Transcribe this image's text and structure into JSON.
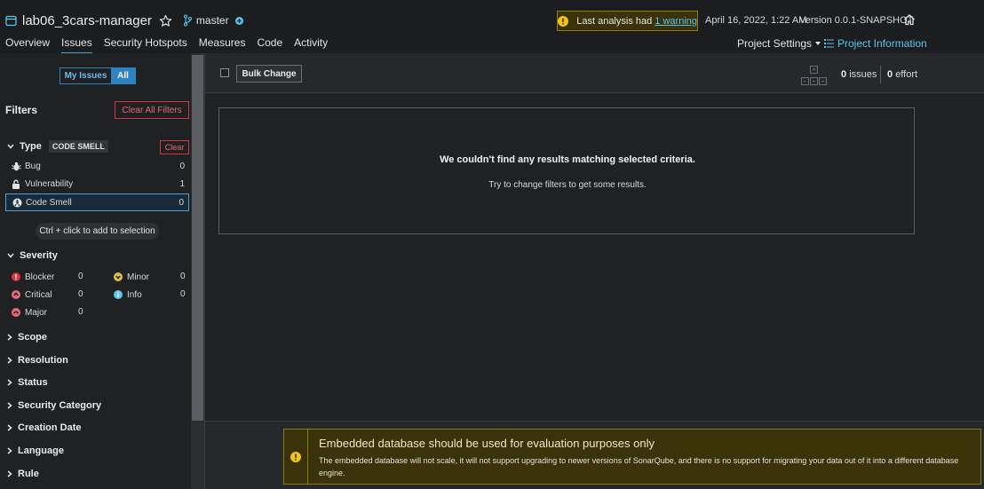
{
  "header": {
    "project_name": "lab06_3cars-manager",
    "branch": "master",
    "warning_prefix": "Last analysis had",
    "warning_link": "1 warning",
    "analysis_date": "April 16, 2022, 1:22 AM",
    "version": "Version 0.0.1-SNAPSHOT",
    "project_settings": "Project Settings",
    "project_information": "Project Information"
  },
  "nav": {
    "overview": "Overview",
    "issues": "Issues",
    "security_hotspots": "Security Hotspots",
    "measures": "Measures",
    "code": "Code",
    "activity": "Activity",
    "active": "Issues"
  },
  "sidebar": {
    "my_issues": "My Issues",
    "all": "All",
    "filters_title": "Filters",
    "clear_all": "Clear All Filters",
    "type": {
      "title": "Type",
      "tag": "CODE SMELL",
      "clear": "Clear",
      "items": [
        {
          "label": "Bug",
          "count": "0",
          "icon": "bug-icon"
        },
        {
          "label": "Vulnerability",
          "count": "1",
          "icon": "lock-icon"
        },
        {
          "label": "Code Smell",
          "count": "0",
          "icon": "code-smell-icon",
          "selected": true
        }
      ],
      "hint": "Ctrl + click to add to selection"
    },
    "severity": {
      "title": "Severity",
      "items": [
        {
          "label": "Blocker",
          "count": "0",
          "color": "#d4333f"
        },
        {
          "label": "Minor",
          "count": "0",
          "color": "#d6c34a"
        },
        {
          "label": "Critical",
          "count": "0",
          "color": "#e36b73"
        },
        {
          "label": "Info",
          "count": "0",
          "color": "#59c5f0"
        },
        {
          "label": "Major",
          "count": "0",
          "color": "#e36b73"
        }
      ]
    },
    "collapsed_facets": [
      "Scope",
      "Resolution",
      "Status",
      "Security Category",
      "Creation Date",
      "Language",
      "Rule"
    ]
  },
  "toolbar": {
    "bulk_change": "Bulk Change",
    "issues_count": "0",
    "issues_label": "issues",
    "effort_count": "0",
    "effort_label": "effort"
  },
  "empty_state": {
    "title": "We couldn't find any results matching selected criteria.",
    "subtitle": "Try to change filters to get some results."
  },
  "db_warning": {
    "title": "Embedded database should be used for evaluation purposes only",
    "text": "The embedded database will not scale, it will not support upgrading to newer versions of SonarQube, and there is no support for migrating your data out of it into a different database engine."
  },
  "colors": {
    "accent": "#2d84c2",
    "link": "#59c5f0",
    "warning_bg": "#3a3208",
    "danger": "#d4333f"
  }
}
